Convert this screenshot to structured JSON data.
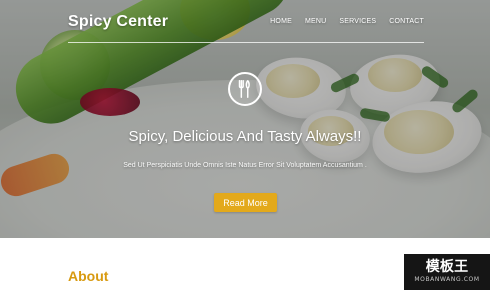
{
  "header": {
    "logo_text": "Spicy Center",
    "nav": [
      {
        "label": "HOME"
      },
      {
        "label": "MENU"
      },
      {
        "label": "SERVICES"
      },
      {
        "label": "CONTACT"
      }
    ]
  },
  "hero": {
    "icon": "cutlery-icon",
    "title": "Spicy, Delicious And Tasty Always!!",
    "subtitle": "Sed Ut Perspiciatis Unde Omnis Iste Natus Error Sit Voluptatem Accusantium .",
    "button_label": "Read More",
    "accent": "#e3a91b"
  },
  "section": {
    "title": "About",
    "title_color": "#d89a10"
  },
  "watermark": {
    "main": "模板王",
    "sub": "MOBANWANG.COM"
  }
}
